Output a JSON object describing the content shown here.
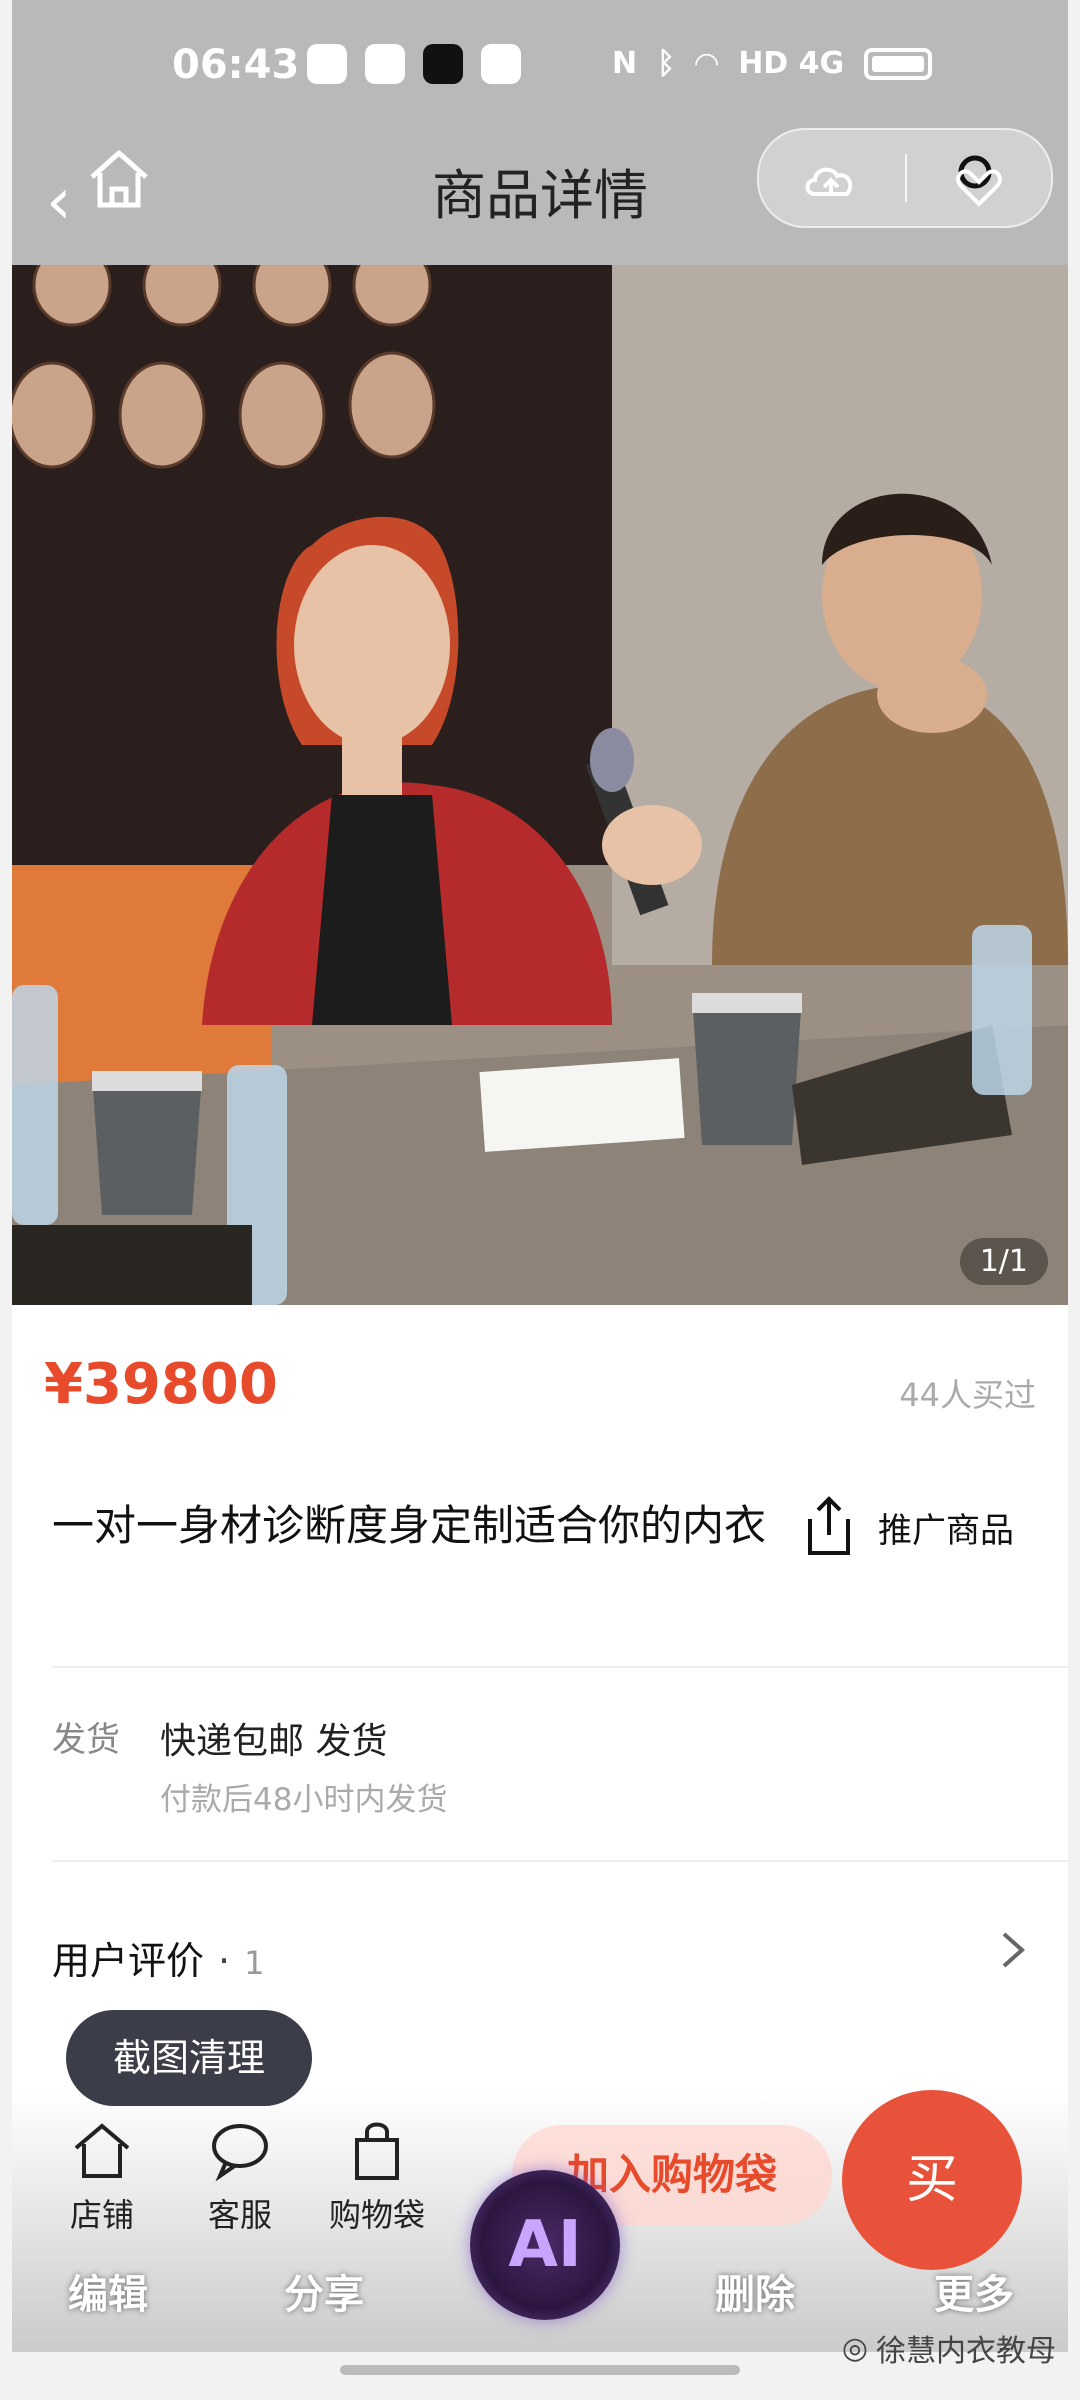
{
  "status_bar": {
    "time": "06:43",
    "signal_text": "HD 4G"
  },
  "header": {
    "title": "商品详情"
  },
  "product": {
    "image_indicator": "1/1",
    "price": "¥39800",
    "sold": "44人买过",
    "title": "一对一身材诊断度身定制适合你的内衣",
    "promote_label": "推广商品"
  },
  "shipping": {
    "label": "发货",
    "value": "快递包邮 发货",
    "sub": "付款后48小时内发货"
  },
  "reviews": {
    "label": "用户评价",
    "dot": "·",
    "count": "1"
  },
  "toast": "截图清理",
  "bottom_bar": {
    "store": "店铺",
    "service": "客服",
    "bag": "购物袋",
    "add_to_cart": "加入购物袋",
    "buy": "买"
  },
  "edit_bar": {
    "edit": "编辑",
    "share": "分享",
    "ai": "AI",
    "delete": "删除",
    "more": "更多"
  },
  "watermark": "徐慧内衣教母",
  "colors": {
    "accent": "#e84a2c",
    "header_bg": "#b9b9b9"
  }
}
